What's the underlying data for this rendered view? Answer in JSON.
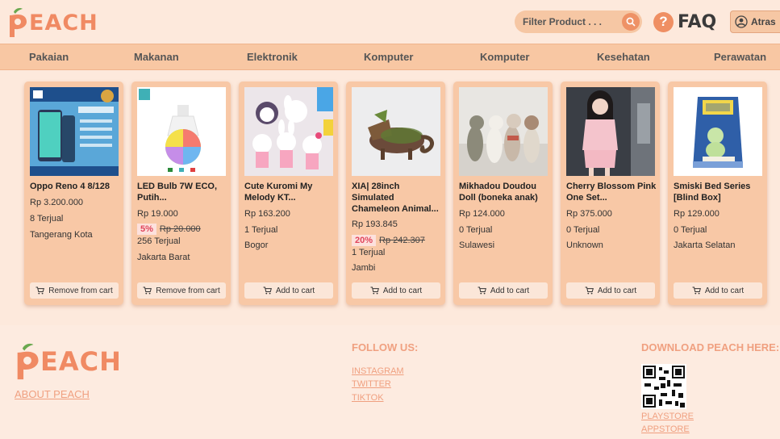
{
  "header": {
    "logo_text": "EACH",
    "search_placeholder": "Filter Product . . .",
    "faq_label": "FAQ",
    "account_name": "Atras"
  },
  "nav": {
    "items": [
      "Pakaian",
      "Makanan",
      "Elektronik",
      "Komputer",
      "Komputer",
      "Kesehatan",
      "Perawatan"
    ]
  },
  "products": [
    {
      "name": "Oppo Reno 4 8/128",
      "price": "Rp 3.200.000",
      "discount": "",
      "original_price": "",
      "sold": "8 Terjual",
      "location": "Tangerang Kota",
      "action": "Remove from cart"
    },
    {
      "name": "LED Bulb 7W ECO, Putih...",
      "price": "Rp 19.000",
      "discount": "5%",
      "original_price": "Rp 20.000",
      "sold": "256 Terjual",
      "location": "Jakarta Barat",
      "action": "Remove from cart"
    },
    {
      "name": "Cute Kuromi My Melody KT...",
      "price": "Rp 163.200",
      "discount": "",
      "original_price": "",
      "sold": "1 Terjual",
      "location": "Bogor",
      "action": "Add to cart"
    },
    {
      "name": "XIA| 28inch Simulated Chameleon Animal...",
      "price": "Rp 193.845",
      "discount": "20%",
      "original_price": "Rp 242.307",
      "sold": "1 Terjual",
      "location": "Jambi",
      "action": "Add to cart"
    },
    {
      "name": "Mikhadou Doudou Doll (boneka anak)",
      "price": "Rp 124.000",
      "discount": "",
      "original_price": "",
      "sold": "0 Terjual",
      "location": "Sulawesi",
      "action": "Add to cart"
    },
    {
      "name": "Cherry Blossom Pink One Set...",
      "price": "Rp 375.000",
      "discount": "",
      "original_price": "",
      "sold": "0 Terjual",
      "location": "Unknown",
      "action": "Add to cart"
    },
    {
      "name": "Smiski Bed Series [Blind Box]",
      "price": "Rp 129.000",
      "discount": "",
      "original_price": "",
      "sold": "0 Terjual",
      "location": "Jakarta Selatan",
      "action": "Add to cart"
    }
  ],
  "footer": {
    "logo_text": "EACH",
    "about_label": "ABOUT PEACH",
    "follow_title": "FOLLOW US:",
    "social": [
      "INSTAGRAM",
      "TWITTER",
      "TIKTOK"
    ],
    "download_title": "DOWNLOAD PEACH HERE:",
    "stores": [
      "PLAYSTORE",
      "APPSTORE"
    ]
  },
  "colors": {
    "brand": "#f08a63",
    "background": "#fde9dc",
    "nav": "#f8c7a3",
    "card": "#f8c8a6",
    "discount_text": "#e0455c"
  },
  "icons": [
    "peach-logo-icon",
    "search-icon",
    "question-icon",
    "user-icon",
    "cart-icon",
    "qr-code-icon"
  ]
}
